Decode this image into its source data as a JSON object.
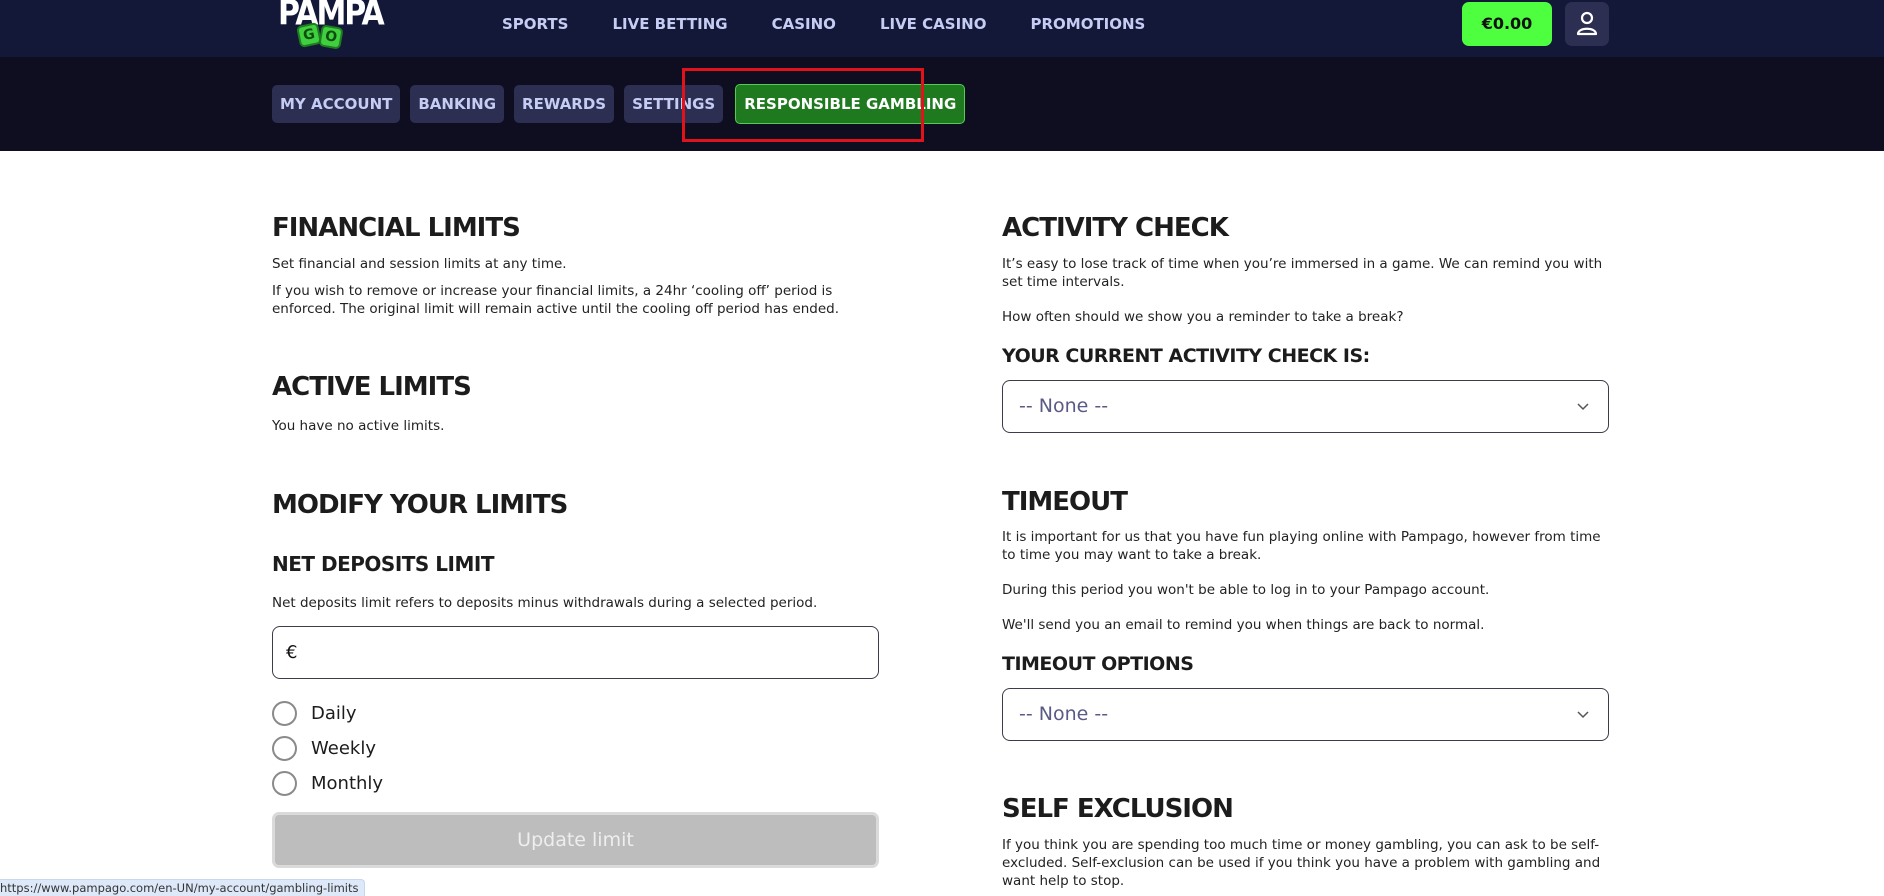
{
  "header": {
    "logo_top": "PAMPA",
    "logo_bottom": [
      "G",
      "O"
    ],
    "nav": [
      "SPORTS",
      "LIVE BETTING",
      "CASINO",
      "LIVE CASINO",
      "PROMOTIONS"
    ],
    "balance": "€0.00",
    "user_icon": "user-icon"
  },
  "account_tabs": [
    {
      "label": "MY ACCOUNT",
      "active": false
    },
    {
      "label": "BANKING",
      "active": false
    },
    {
      "label": "REWARDS",
      "active": false
    },
    {
      "label": "SETTINGS",
      "active": false
    },
    {
      "label": "RESPONSIBLE GAMBLING",
      "active": true
    }
  ],
  "colors": {
    "nav_bg": "#141838",
    "subnav_bg": "#0e0e20",
    "tab_bg": "#2c2e52",
    "active_tab_bg": "#1f7a1f",
    "balance_bg": "#4dff3f",
    "highlight": "#e0131c"
  },
  "financial_limits": {
    "title": "FINANCIAL LIMITS",
    "desc1": "Set financial and session limits at any time.",
    "desc2": "If you wish to remove or increase your financial limits, a 24hr ‘cooling off’ period is enforced. The original limit will remain active until the cooling off period has ended."
  },
  "active_limits": {
    "title": "ACTIVE LIMITS",
    "desc": "You have no active limits."
  },
  "modify_limits": {
    "title": "MODIFY YOUR LIMITS",
    "net_deposits": {
      "title": "NET DEPOSITS LIMIT",
      "desc": "Net deposits limit refers to deposits minus withdrawals during a selected period.",
      "currency_symbol": "€",
      "amount_value": "",
      "periods": [
        "Daily",
        "Weekly",
        "Monthly"
      ],
      "selected_period": null,
      "update_button": "Update limit"
    }
  },
  "activity_check": {
    "title": "ACTIVITY CHECK",
    "desc1": "It’s easy to lose track of time when you’re immersed in a game. We can remind you with set time intervals.",
    "desc2": "How often should we show you a reminder to take a break?",
    "current_label": "YOUR CURRENT ACTIVITY CHECK IS:",
    "selected": "-- None --"
  },
  "timeout": {
    "title": "TIMEOUT",
    "desc1": "It is important for us that you have fun playing online with Pampago, however from time to time you may want to take a break.",
    "desc2": "During this period you won't be able to log in to your Pampago account.",
    "desc3": "We'll send you an email to remind you when things are back to normal.",
    "options_label": "TIMEOUT OPTIONS",
    "selected": "-- None --"
  },
  "self_exclusion": {
    "title": "SELF EXCLUSION",
    "desc": "If you think you are spending too much time or money gambling, you can ask to be self-excluded. Self-exclusion can be used if you think you have a problem with gambling and want help to stop."
  },
  "status_bar": {
    "url": "https://www.pampago.com/en-UN/my-account/gambling-limits"
  }
}
